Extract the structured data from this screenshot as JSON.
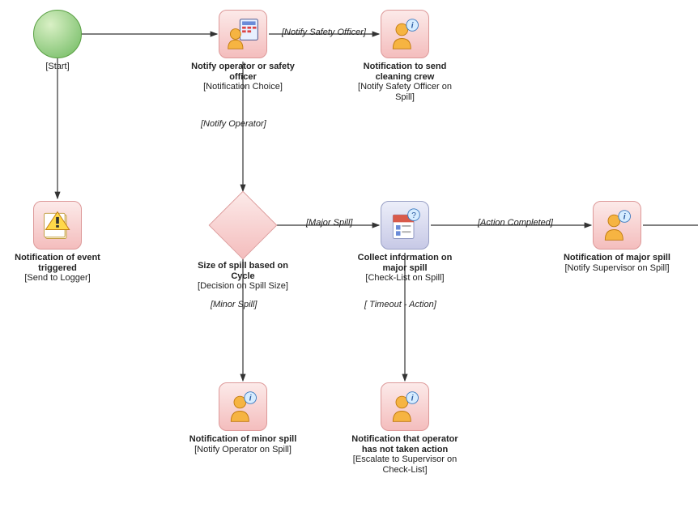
{
  "nodes": {
    "start": {
      "title": "",
      "sub": "[Start]"
    },
    "notify_officer": {
      "title": "Notify operator or safety officer",
      "sub": "[Notification Choice]"
    },
    "notify_crew": {
      "title": "Notification to send cleaning crew",
      "sub": "[Notify Safety Officer on Spill]"
    },
    "event_triggered": {
      "title": "Notification of event triggered",
      "sub": "[Send to Logger]"
    },
    "spill_size": {
      "title": "Size of spill based on Cycle",
      "sub": "[Decision on Spill Size]"
    },
    "collect_info": {
      "title": "Collect information on major spill",
      "sub": "[Check-List on Spill]"
    },
    "major_spill": {
      "title": "Notification of major spill",
      "sub": "[Notify Supervisor on Spill]"
    },
    "minor_spill": {
      "title": "Notification of minor spill",
      "sub": "[Notify Operator on Spill]"
    },
    "not_taken_action": {
      "title": "Notification that operator has not taken action",
      "sub": "[Escalate to Supervisor on Check-List]"
    }
  },
  "edges": {
    "e0": "[Notify Safety Officer]",
    "e1": "[Notify Operator]",
    "e2": "[Major Spill]",
    "e3": "[Action Completed]",
    "e4": "[Minor Spill]",
    "e5": "[ Timeout - Action]"
  }
}
